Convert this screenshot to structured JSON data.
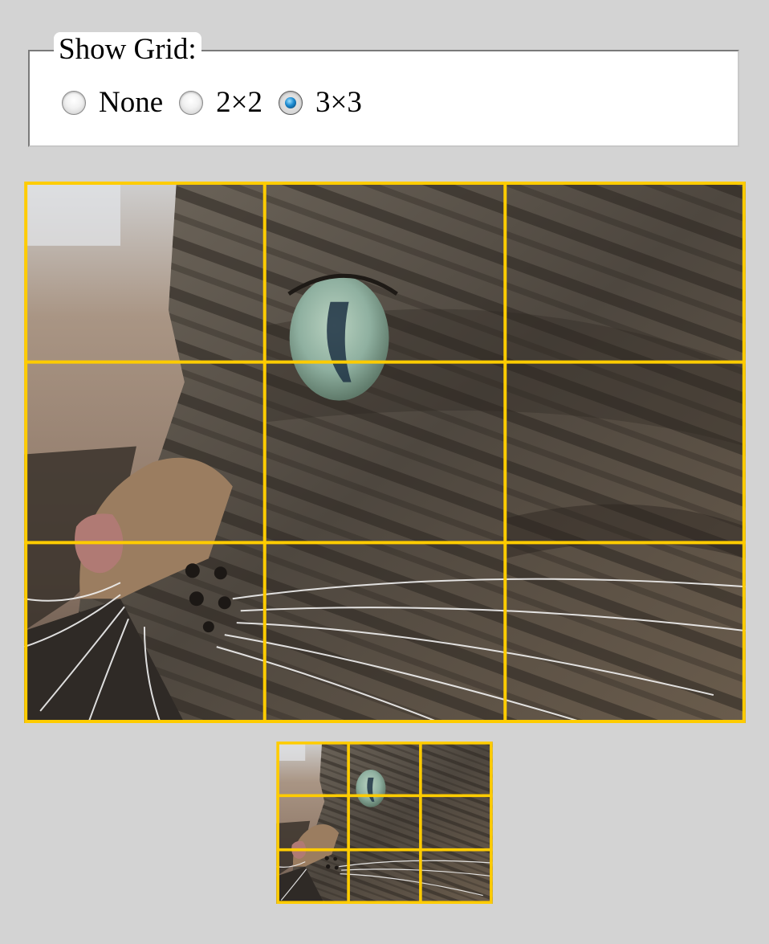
{
  "grid_options": {
    "legend": "Show Grid:",
    "options": [
      {
        "label": "None",
        "checked": false
      },
      {
        "label": "2×2",
        "checked": false
      },
      {
        "label": "3×3",
        "checked": true
      }
    ],
    "selected": "3×3"
  },
  "grid": {
    "rows": 3,
    "cols": 3,
    "line_color": "#ffcc00"
  },
  "images": {
    "main_subject": "tabby-cat-closeup",
    "thumbnail_subject": "tabby-cat-closeup"
  }
}
